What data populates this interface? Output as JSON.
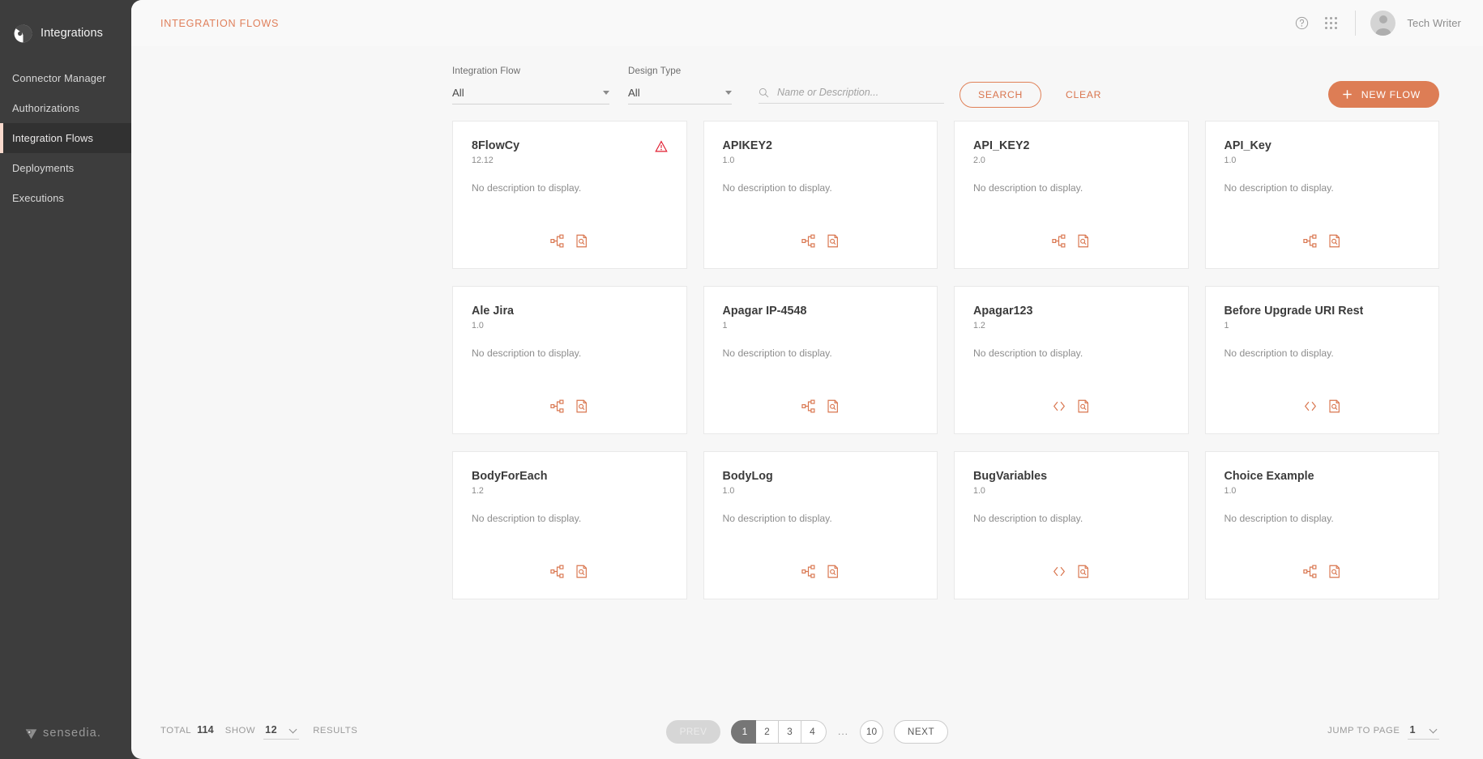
{
  "sidebar": {
    "brand": {
      "label": "Integrations",
      "logo_icon": "integrations-logo-icon"
    },
    "items": [
      {
        "label": "Connector Manager",
        "active": false
      },
      {
        "label": "Authorizations",
        "active": false
      },
      {
        "label": "Integration Flows",
        "active": true
      },
      {
        "label": "Deployments",
        "active": false
      },
      {
        "label": "Executions",
        "active": false
      }
    ],
    "footer": {
      "label": "sensedia.",
      "logo_icon": "sensedia-logo-icon"
    },
    "colors": {
      "bg": "#3d3d3d",
      "active_bg": "#313131",
      "active_marker": "#f8d9cc"
    }
  },
  "topbar": {
    "kicker": "INTEGRATION FLOWS",
    "help_icon": "help-circle-icon",
    "apps_icon": "apps-grid-icon",
    "user_name": "Tech Writer"
  },
  "filters": {
    "integration_flow": {
      "label": "Integration Flow",
      "value": "All",
      "options": [
        "All"
      ]
    },
    "design_type": {
      "label": "Design Type",
      "value": "All",
      "options": [
        "All"
      ]
    },
    "search": {
      "icon": "search-icon",
      "value": "",
      "placeholder": "Name or Description..."
    },
    "search_button": "SEARCH",
    "clear_button": "CLEAR",
    "new_flow_button": "NEW FLOW",
    "new_flow_icon": "plus-icon"
  },
  "cards": [
    {
      "name": "8FlowCy",
      "version": "12.12",
      "description": "No description to display.",
      "warning": true,
      "design_icon": "flow-sitemap-icon",
      "doc_icon": "document-search-icon"
    },
    {
      "name": "APIKEY2",
      "version": "1.0",
      "description": "No description to display.",
      "warning": false,
      "design_icon": "flow-sitemap-icon",
      "doc_icon": "document-search-icon"
    },
    {
      "name": "API_KEY2",
      "version": "2.0",
      "description": "No description to display.",
      "warning": false,
      "design_icon": "flow-sitemap-icon",
      "doc_icon": "document-search-icon"
    },
    {
      "name": "API_Key",
      "version": "1.0",
      "description": "No description to display.",
      "warning": false,
      "design_icon": "flow-sitemap-icon",
      "doc_icon": "document-search-icon"
    },
    {
      "name": "Ale Jira",
      "version": "1.0",
      "description": "No description to display.",
      "warning": false,
      "design_icon": "flow-sitemap-icon",
      "doc_icon": "document-search-icon"
    },
    {
      "name": "Apagar IP-4548",
      "version": "1",
      "description": "No description to display.",
      "warning": false,
      "design_icon": "flow-sitemap-icon",
      "doc_icon": "document-search-icon"
    },
    {
      "name": "Apagar123",
      "version": "1.2",
      "description": "No description to display.",
      "warning": false,
      "design_icon": "code-brackets-icon",
      "doc_icon": "document-search-icon"
    },
    {
      "name": "Before Upgrade URI Rest",
      "version": "1",
      "description": "No description to display.",
      "warning": false,
      "design_icon": "code-brackets-icon",
      "doc_icon": "document-search-icon"
    },
    {
      "name": "BodyForEach",
      "version": "1.2",
      "description": "No description to display.",
      "warning": false,
      "design_icon": "flow-sitemap-icon",
      "doc_icon": "document-search-icon"
    },
    {
      "name": "BodyLog",
      "version": "1.0",
      "description": "No description to display.",
      "warning": false,
      "design_icon": "flow-sitemap-icon",
      "doc_icon": "document-search-icon"
    },
    {
      "name": "BugVariables",
      "version": "1.0",
      "description": "No description to display.",
      "warning": false,
      "design_icon": "code-brackets-icon",
      "doc_icon": "document-search-icon"
    },
    {
      "name": "Choice Example",
      "version": "1.0",
      "description": "No description to display.",
      "warning": false,
      "design_icon": "flow-sitemap-icon",
      "doc_icon": "document-search-icon"
    }
  ],
  "footer": {
    "total_label": "TOTAL",
    "total_value": "114",
    "show_label": "SHOW",
    "show_value": "12",
    "results_label": "RESULTS",
    "prev_label": "PREV",
    "next_label": "NEXT",
    "pages": [
      "1",
      "2",
      "3",
      "4"
    ],
    "ellipsis": "...",
    "last_page": "10",
    "active_page": "1",
    "jump_label": "JUMP TO PAGE",
    "jump_value": "1"
  },
  "theme": {
    "accent": "#dd7d55",
    "accent_text": "#d9764f",
    "kicker": "#e0805c",
    "warning": "#e01b2e",
    "page_bg": "#f7f7f7",
    "card_bg": "#ffffff"
  }
}
